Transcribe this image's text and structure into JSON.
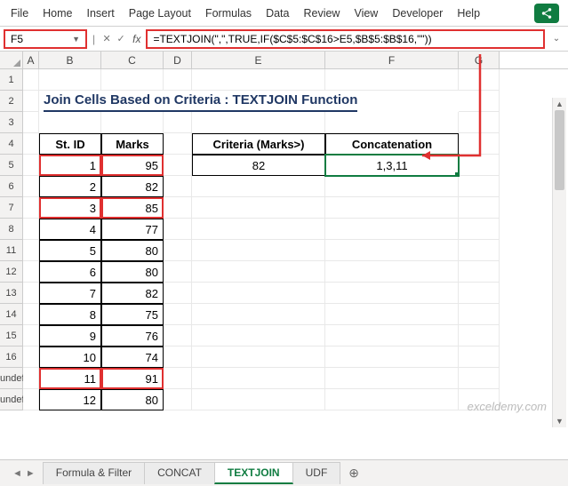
{
  "menu": {
    "items": [
      "File",
      "Home",
      "Insert",
      "Page Layout",
      "Formulas",
      "Data",
      "Review",
      "View",
      "Developer",
      "Help"
    ]
  },
  "name_box": "F5",
  "formula": "=TEXTJOIN(\",\",TRUE,IF($C$5:$C$16>E5,$B$5:$B$16,\"\"))",
  "title": "Join Cells Based on Criteria : TEXTJOIN Function",
  "cols": [
    "A",
    "B",
    "C",
    "D",
    "E",
    "F",
    "G"
  ],
  "row_nums": [
    "1",
    "2",
    "3",
    "4",
    "5",
    "6",
    "7",
    "8",
    "11",
    "12",
    "13",
    "14",
    "15",
    "16"
  ],
  "table": {
    "headers": [
      "St. ID",
      "Marks"
    ],
    "rows": [
      {
        "id": "1",
        "marks": "95",
        "hl": true
      },
      {
        "id": "2",
        "marks": "82",
        "hl": false
      },
      {
        "id": "3",
        "marks": "85",
        "hl": true
      },
      {
        "id": "4",
        "marks": "77",
        "hl": false
      },
      {
        "id": "5",
        "marks": "80",
        "hl": false
      },
      {
        "id": "6",
        "marks": "80",
        "hl": false
      },
      {
        "id": "7",
        "marks": "82",
        "hl": false
      },
      {
        "id": "8",
        "marks": "75",
        "hl": false
      },
      {
        "id": "9",
        "marks": "76",
        "hl": false
      },
      {
        "id": "10",
        "marks": "74",
        "hl": false
      },
      {
        "id": "11",
        "marks": "91",
        "hl": true
      },
      {
        "id": "12",
        "marks": "80",
        "hl": false
      }
    ]
  },
  "criteria": {
    "header1": "Criteria (Marks>)",
    "header2": "Concatenation",
    "value": "82",
    "result": "1,3,11"
  },
  "tabs": {
    "items": [
      "Formula & Filter",
      "CONCAT",
      "TEXTJOIN",
      "UDF"
    ],
    "active": 2
  },
  "watermark": "exceldemy.com"
}
